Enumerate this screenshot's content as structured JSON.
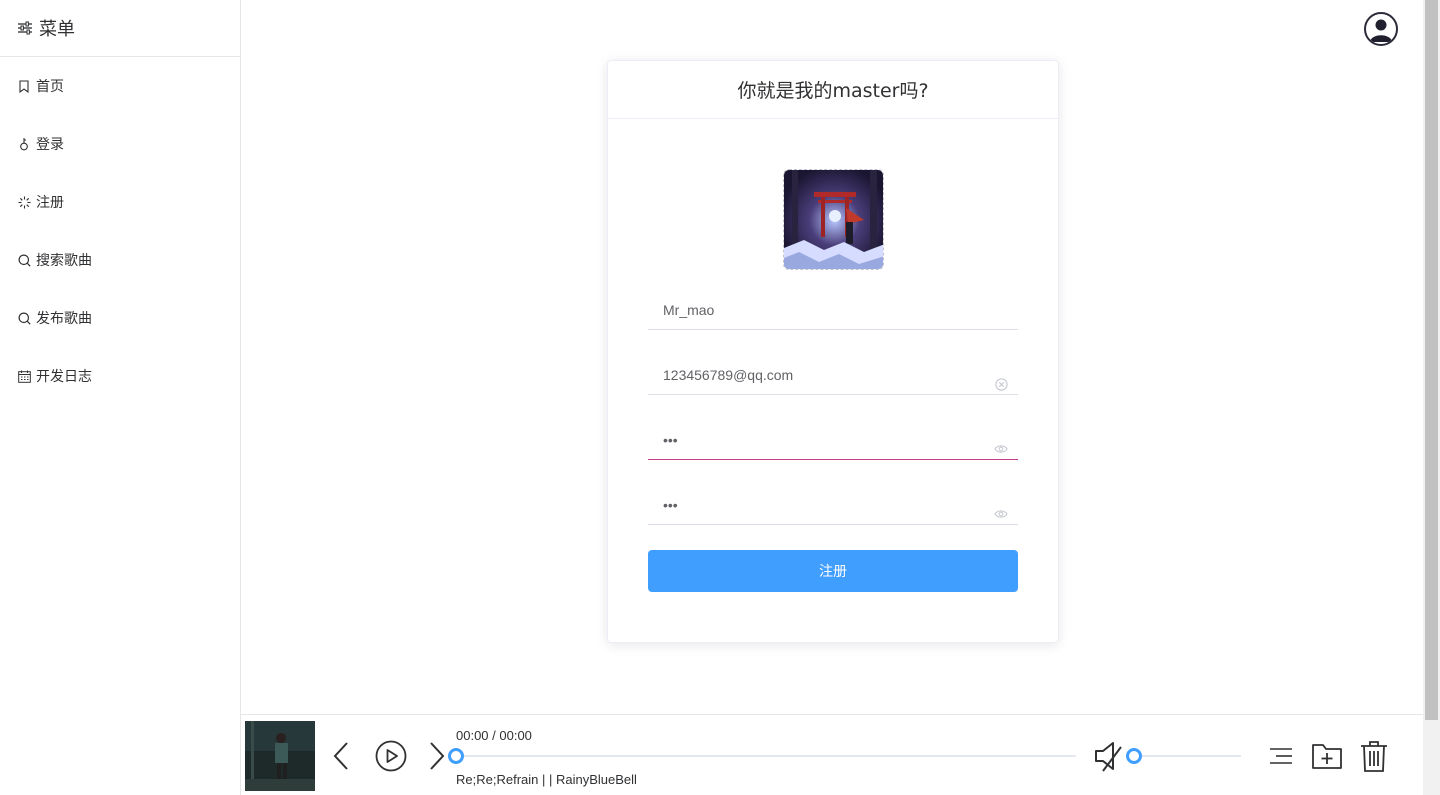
{
  "sidebar": {
    "title": "菜单",
    "items": [
      {
        "label": "首页",
        "icon": "bookmark-icon"
      },
      {
        "label": "登录",
        "icon": "key-icon"
      },
      {
        "label": "注册",
        "icon": "loading-icon"
      },
      {
        "label": "搜索歌曲",
        "icon": "search-icon"
      },
      {
        "label": "发布歌曲",
        "icon": "search-icon"
      },
      {
        "label": "开发日志",
        "icon": "calendar-icon"
      }
    ]
  },
  "form": {
    "title": "你就是我的master吗?",
    "username": "Mr_mao",
    "email": "123456789@qq.com",
    "password": "•••",
    "confirm_password": "•••",
    "submit_label": "注册"
  },
  "player": {
    "time": "00:00 / 00:00",
    "song": "Re;Re;Refrain | | RainyBlueBell",
    "progress": 0,
    "volume": 0
  },
  "colors": {
    "primary": "#409eff",
    "focus_underline": "#c33f8b"
  }
}
